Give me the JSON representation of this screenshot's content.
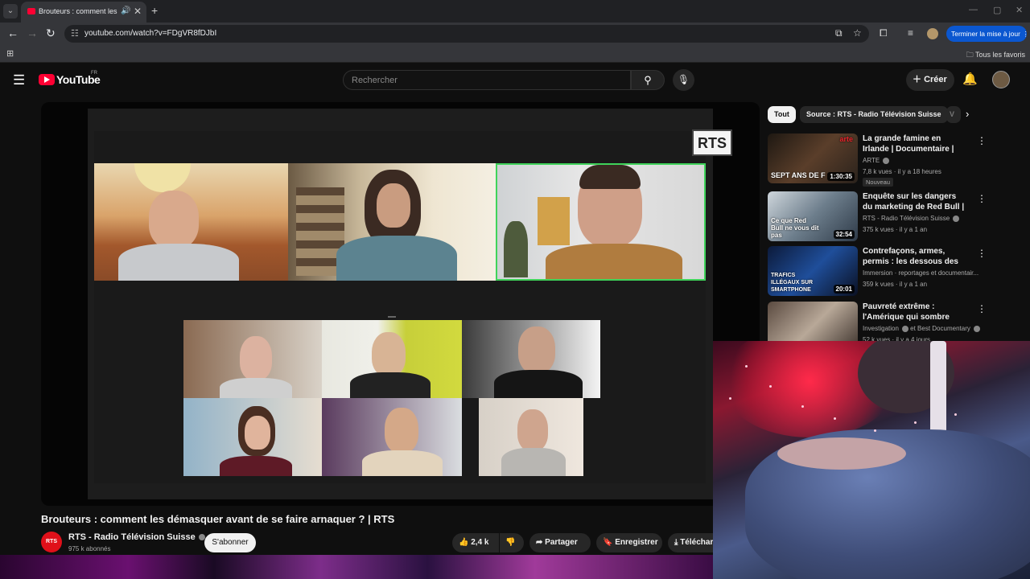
{
  "browser": {
    "tab_title": "Brouteurs : comment les dé",
    "url": "youtube.com/watch?v=FDgVR8fDJbI",
    "update_button": "Terminer la mise à jour",
    "bookmarks_all": "Tous les favoris"
  },
  "masthead": {
    "logo_text": "YouTube",
    "country_code": "FR",
    "search_placeholder": "Rechercher",
    "create_label": "Créer"
  },
  "video": {
    "overlay_logo": "RTS",
    "title": "Brouteurs : comment les démasquer avant de se faire arnaquer ? | RTS",
    "channel_avatar_text": "RTS",
    "channel_name": "RTS - Radio Télévision Suisse",
    "subscribers": "975 k abonnés",
    "subscribe_label": "S'abonner",
    "likes": "2,4 k",
    "share_label": "Partager",
    "save_label": "Enregistrer",
    "download_label": "Téléchar"
  },
  "chips": [
    "Tout",
    "Source : RTS - Radio Télévision Suisse",
    "V"
  ],
  "recommendations": [
    {
      "title": "La grande famine en Irlande | Documentaire | ARTE",
      "channel": "ARTE",
      "meta": "7,8 k vues · il y a 18 heures",
      "badge": "Nouveau",
      "duration": "1:30:35",
      "thumb_text": "SEPT ANS DE F",
      "thumb_brand": "arte"
    },
    {
      "title": "Enquête sur les dangers du marketing de Red Bull | RTS",
      "channel": "RTS - Radio Télévision Suisse",
      "meta": "375 k vues · il y a 1 an",
      "duration": "32:54",
      "thumb_text": "Ce que Red Bull ne vous dit pas"
    },
    {
      "title": "Contrefaçons, armes, permis : les dessous des trafiquants",
      "channel": "Immersion · reportages et documentair...",
      "meta": "359 k vues · il y a 1 an",
      "duration": "20:01",
      "thumb_text": "TRAFICS ILLÉGAUX SUR SMARTPHONE"
    },
    {
      "title": "Pauvreté extrême : l'Amérique qui sombre",
      "channel": "Investigation",
      "channel_extra": "et Best Documentary",
      "meta": "52 k vues · il y a 4 jours"
    }
  ],
  "colors": {
    "youtube_red": "#ff0033",
    "update_blue": "#0b57d0",
    "active_speaker_border": "#3fd35a"
  }
}
